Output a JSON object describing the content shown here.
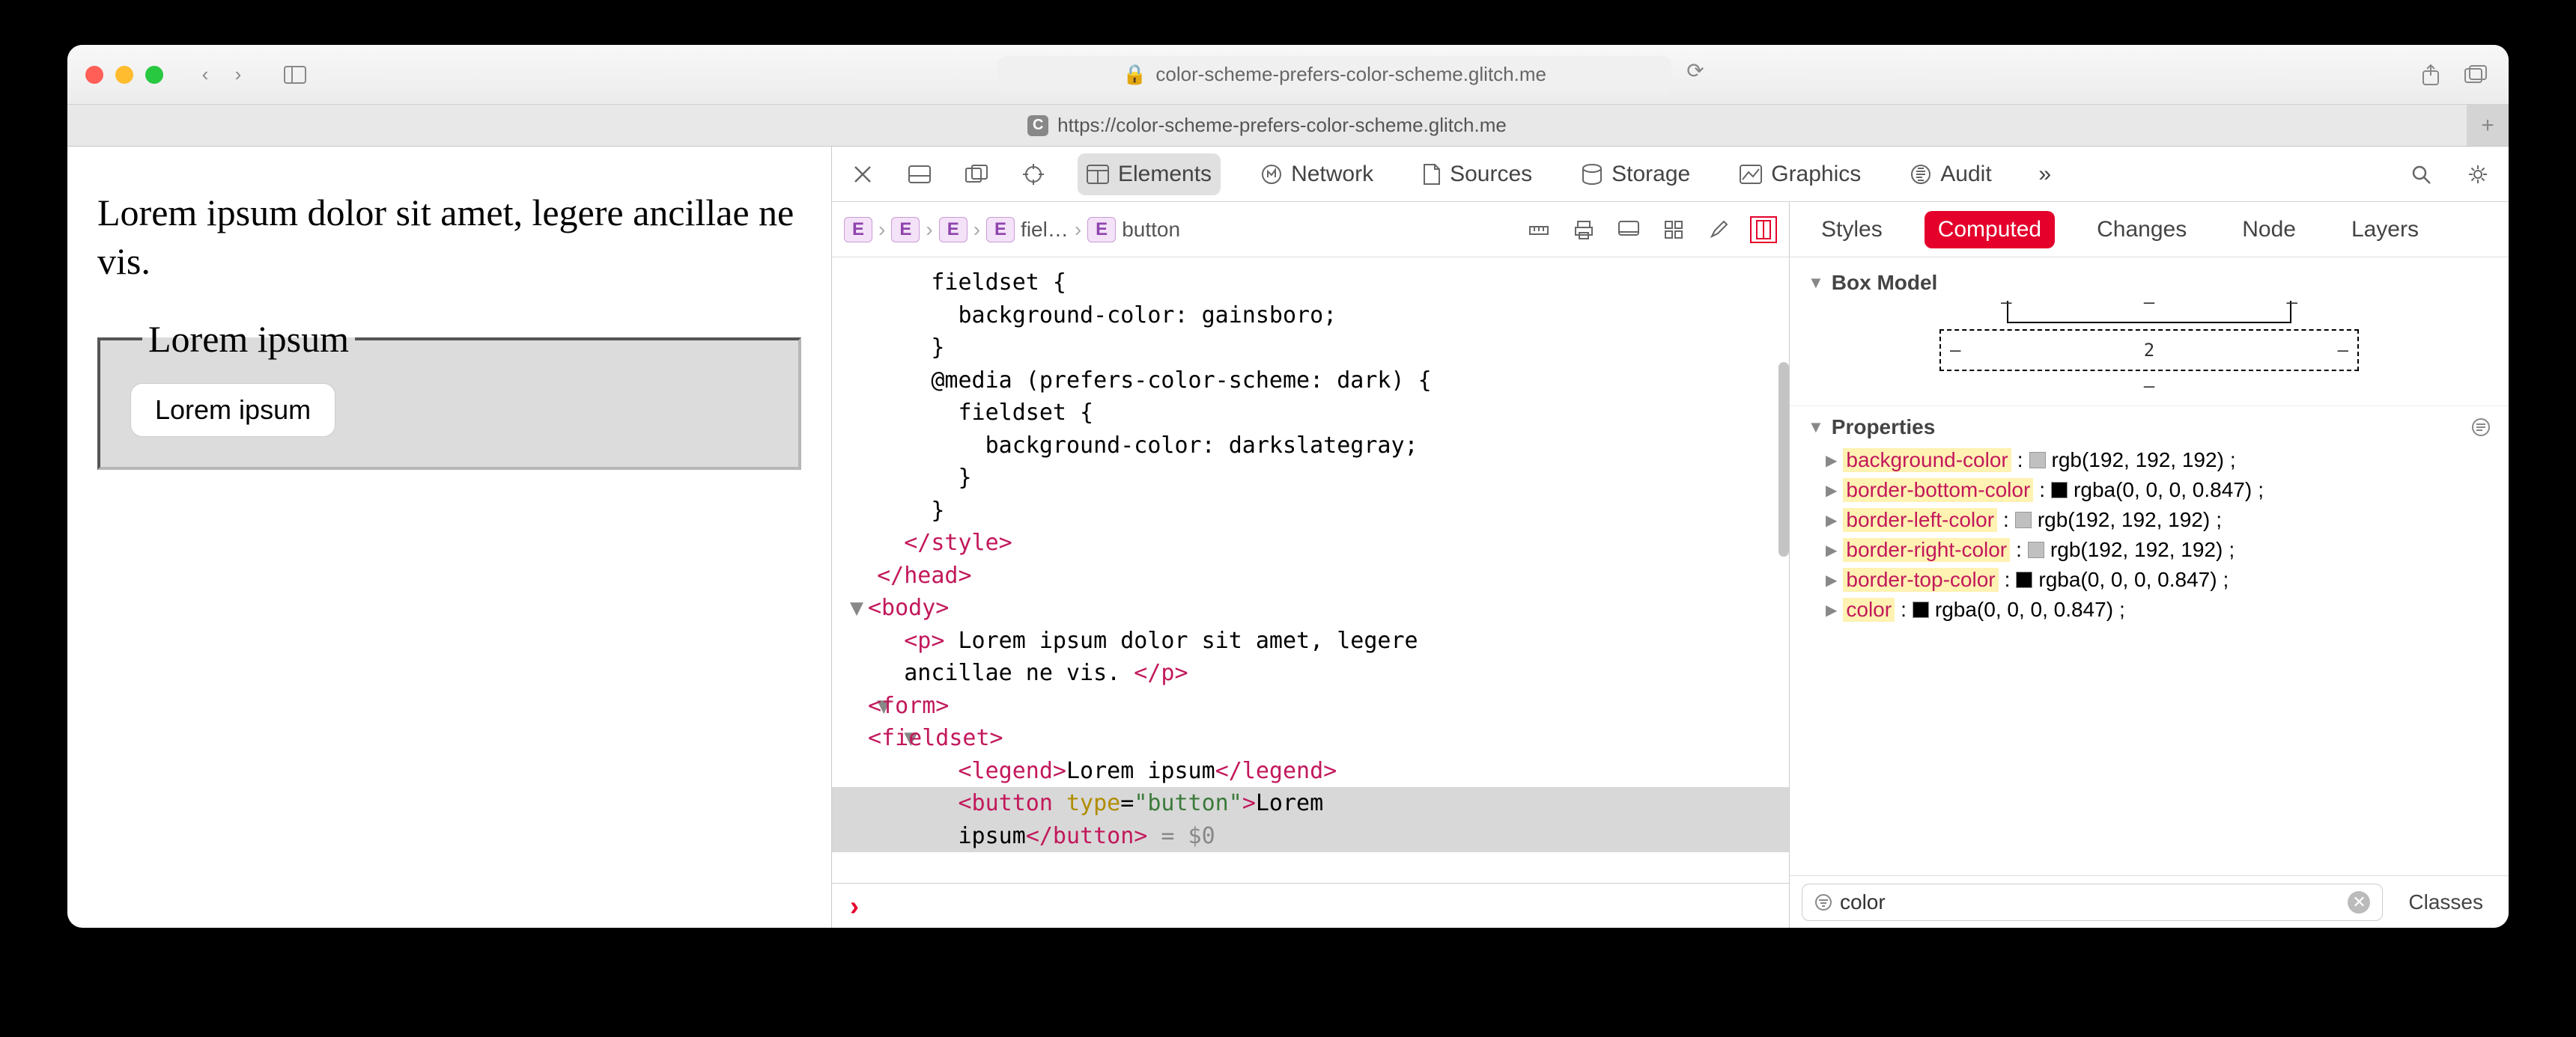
{
  "browser": {
    "url_display": "color-scheme-prefers-color-scheme.glitch.me",
    "tab_url": "https://color-scheme-prefers-color-scheme.glitch.me",
    "favicon_letter": "C"
  },
  "page": {
    "paragraph": "Lorem ipsum dolor sit amet, legere ancillae ne vis.",
    "legend": "Lorem ipsum",
    "button_label": "Lorem ipsum"
  },
  "devtools": {
    "tabs": {
      "elements": "Elements",
      "network": "Network",
      "sources": "Sources",
      "storage": "Storage",
      "graphics": "Graphics",
      "audit": "Audit"
    },
    "breadcrumb": {
      "e_label": "E",
      "fieldset": "fiel…",
      "button": "button"
    },
    "dom": {
      "l1": "      fieldset {",
      "l2": "        background-color: gainsboro;",
      "l3": "      }",
      "l4": "      @media (prefers-color-scheme: dark) {",
      "l5": "        fieldset {",
      "l6": "          background-color: darkslategray;",
      "l7": "        }",
      "l8": "      }",
      "l9a": "    ",
      "l9b": "</style>",
      "l10a": "  ",
      "l10b": "</head>",
      "l11tri": "▼ ",
      "l11": "<body>",
      "l12a": "    ",
      "l12b": "<p>",
      "l12c": " Lorem ipsum dolor sit amet, legere",
      "l12d": "    ancillae ne vis. ",
      "l12e": "</p>",
      "l13tri": "  ▼ ",
      "l13": "<form>",
      "l14tri": "    ▼ ",
      "l14": "<fieldset>",
      "l15a": "        ",
      "l15b": "<legend>",
      "l15c": "Lorem ipsum",
      "l15d": "</legend>",
      "l16a": "        ",
      "l16b": "<button",
      "l16c": " type",
      "l16d": "=",
      "l16e": "\"button\"",
      "l16f": ">",
      "l16g": "Lorem",
      "l17a": "        ipsum",
      "l17b": "</button>",
      "l17c": " = $0"
    },
    "styles_tabs": {
      "styles": "Styles",
      "computed": "Computed",
      "changes": "Changes",
      "node": "Node",
      "layers": "Layers"
    },
    "box_model": {
      "header": "Box Model",
      "dash": "—",
      "margin_bottom": "2"
    },
    "properties": {
      "header": "Properties",
      "rows": [
        {
          "name": "background-color",
          "swatch": "#c0c0c0",
          "value": "rgb(192, 192, 192)"
        },
        {
          "name": "border-bottom-color",
          "swatch": "#000000",
          "value": "rgba(0, 0, 0, 0.847)"
        },
        {
          "name": "border-left-color",
          "swatch": "#c0c0c0",
          "value": "rgb(192, 192, 192)"
        },
        {
          "name": "border-right-color",
          "swatch": "#c0c0c0",
          "value": "rgb(192, 192, 192)"
        },
        {
          "name": "border-top-color",
          "swatch": "#000000",
          "value": "rgba(0, 0, 0, 0.847)"
        },
        {
          "name": "color",
          "swatch": "#000000",
          "value": "rgba(0, 0, 0, 0.847)"
        }
      ]
    },
    "filter": {
      "value": "color",
      "classes_label": "Classes"
    }
  }
}
